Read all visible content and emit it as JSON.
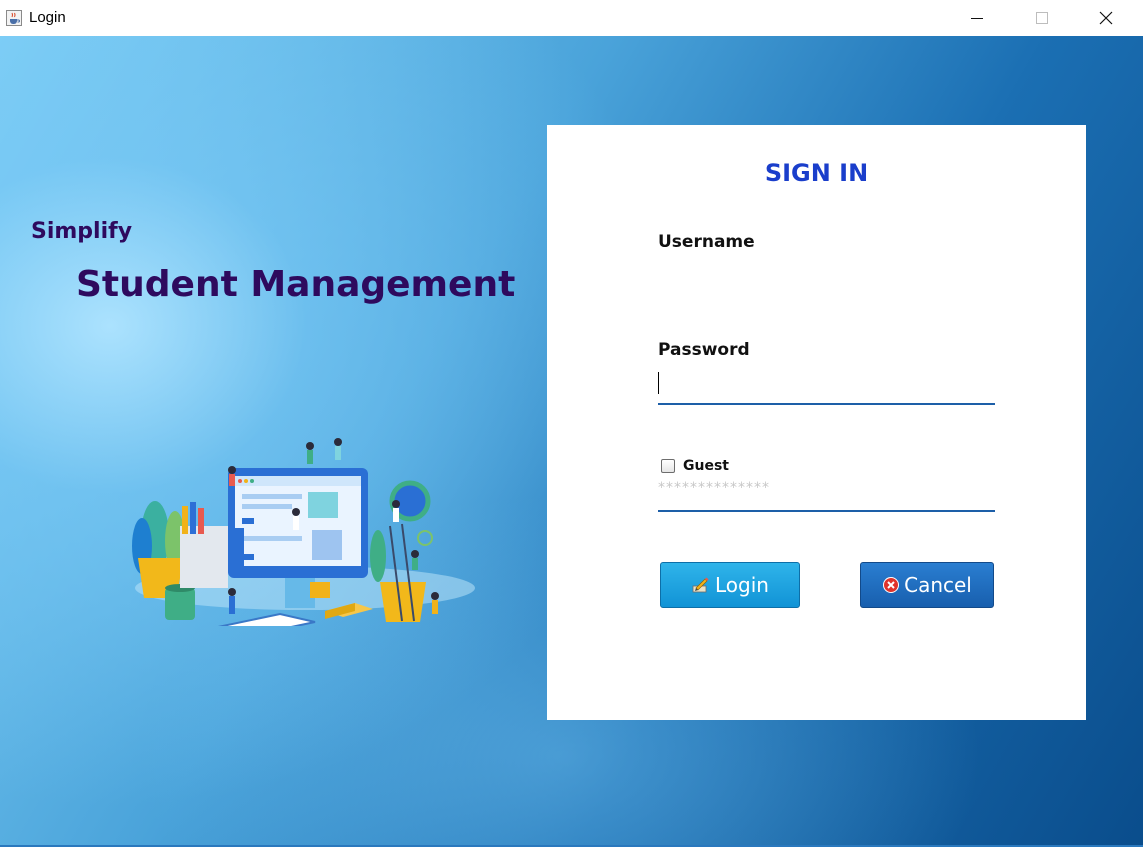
{
  "window": {
    "title": "Login",
    "icon": "java-cup-icon",
    "controls": [
      "minimize-icon",
      "maximize-icon",
      "close-icon"
    ]
  },
  "hero": {
    "tagline_small": "Simplify",
    "tagline_large": "Student Management",
    "illustration": "student-management-illustration"
  },
  "form": {
    "heading": "SIGN IN",
    "username_label": "Username",
    "username_value": "",
    "password_label": "Password",
    "password_mask": "**************",
    "guest_label": "Guest",
    "guest_checked": false,
    "login_label": "Login",
    "login_icon": "pencil-icon",
    "cancel_label": "Cancel",
    "cancel_icon": "cancel-x-icon"
  },
  "colors": {
    "heading": "#1a3ecb",
    "tagline": "#2e0a5e",
    "underline": "#1d5fa8",
    "login_button": "#1ea3e0",
    "cancel_button": "#1f6dbf"
  }
}
